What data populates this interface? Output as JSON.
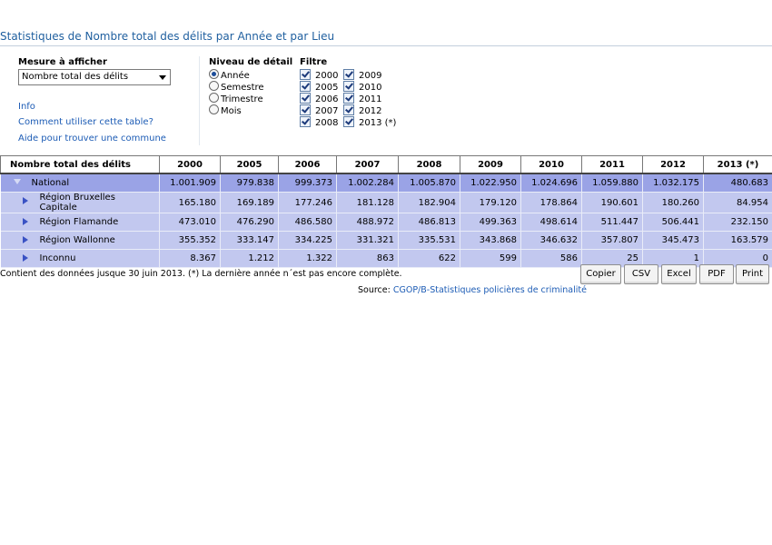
{
  "page": {
    "title": "Statistiques de Nombre total des délits par Année et par Lieu"
  },
  "measure": {
    "label": "Mesure à afficher",
    "selected": "Nombre total des délits"
  },
  "links": [
    "Info",
    "Comment utiliser cette table?",
    "Aide pour trouver une commune"
  ],
  "detail": {
    "label": "Niveau de détail",
    "options": [
      "Année",
      "Semestre",
      "Trimestre",
      "Mois"
    ],
    "selected": "Année"
  },
  "filter": {
    "label": "Filtre",
    "col1": [
      "2000",
      "2005",
      "2006",
      "2007",
      "2008"
    ],
    "col2": [
      "2009",
      "2010",
      "2011",
      "2012",
      "2013 (*)"
    ],
    "checked": true
  },
  "table": {
    "headers": [
      "Nombre total des délits",
      "2000",
      "2005",
      "2006",
      "2007",
      "2008",
      "2009",
      "2010",
      "2011",
      "2012",
      "2013 (*)"
    ],
    "rows": [
      {
        "label": "National",
        "values": [
          "1.001.909",
          "979.838",
          "999.373",
          "1.002.284",
          "1.005.870",
          "1.022.950",
          "1.024.696",
          "1.059.880",
          "1.032.175",
          "480.683"
        ]
      },
      {
        "label": "Région Bruxelles Capitale",
        "values": [
          "165.180",
          "169.189",
          "177.246",
          "181.128",
          "182.904",
          "179.120",
          "178.864",
          "190.601",
          "180.260",
          "84.954"
        ]
      },
      {
        "label": "Région Flamande",
        "values": [
          "473.010",
          "476.290",
          "486.580",
          "488.972",
          "486.813",
          "499.363",
          "498.614",
          "511.447",
          "506.441",
          "232.150"
        ]
      },
      {
        "label": "Région Wallonne",
        "values": [
          "355.352",
          "333.147",
          "334.225",
          "331.321",
          "335.531",
          "343.868",
          "346.632",
          "357.807",
          "345.473",
          "163.579"
        ]
      },
      {
        "label": "Inconnu",
        "values": [
          "8.367",
          "1.212",
          "1.322",
          "863",
          "622",
          "599",
          "586",
          "25",
          "1",
          "0"
        ]
      }
    ]
  },
  "footer": {
    "note": "Contient des données jusque 30 juin 2013.   (*) La dernière année n´est pas encore complète.",
    "source_prefix": "Source: ",
    "source_link": "CGOP/B-Statistiques policières de criminalité"
  },
  "buttons": {
    "copy": "Copier",
    "csv": "CSV",
    "excel": "Excel",
    "pdf": "PDF",
    "print": "Print"
  },
  "colors": {
    "title": "#1f5f9f",
    "link": "#1d5cb5",
    "national_row": "#9aa3e6",
    "region_row": "#c2c8ef",
    "expand_arrow": "#3a52c4"
  }
}
